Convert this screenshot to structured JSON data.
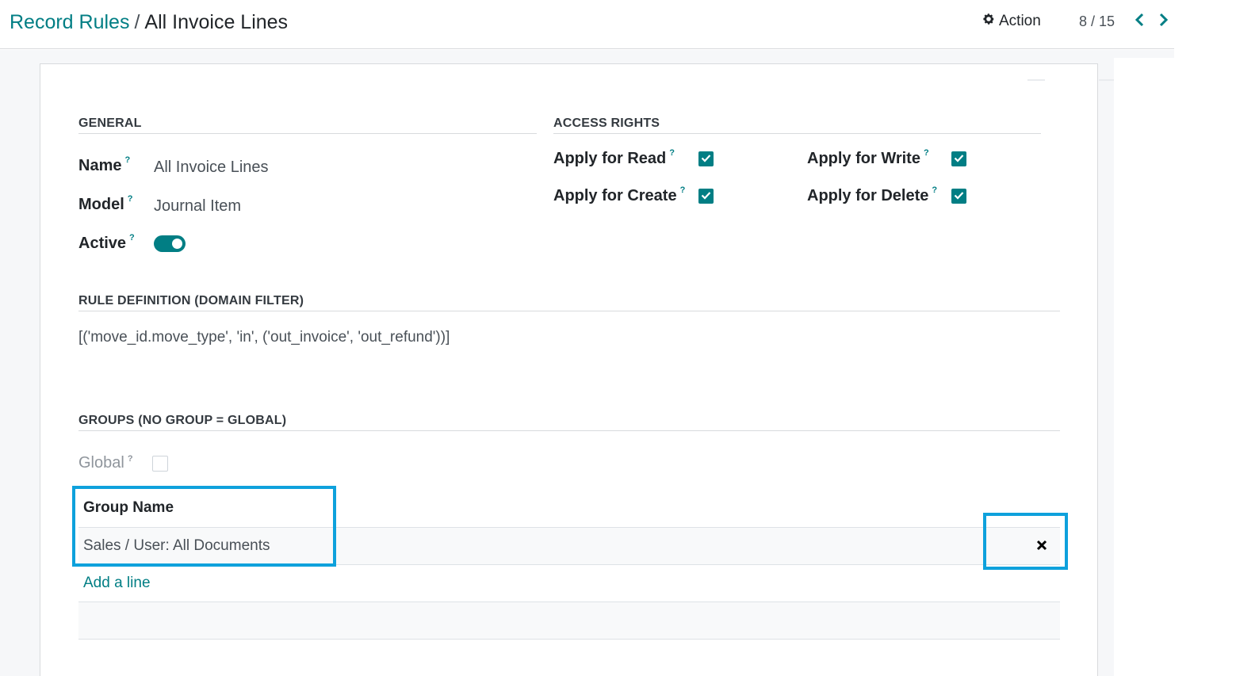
{
  "breadcrumb": {
    "parent": "Record Rules",
    "separator": "/",
    "current": "All Invoice Lines"
  },
  "header": {
    "action_label": "Action",
    "pager_value": "8 / 15"
  },
  "general": {
    "title": "GENERAL",
    "help_mark": "?",
    "name_label": "Name",
    "name_value": "All Invoice Lines",
    "model_label": "Model",
    "model_value": "Journal Item",
    "active_label": "Active",
    "active": true
  },
  "access_rights": {
    "title": "ACCESS RIGHTS",
    "read_label": "Apply for Read",
    "write_label": "Apply for Write",
    "create_label": "Apply for Create",
    "delete_label": "Apply for Delete",
    "read": true,
    "write": true,
    "create": true,
    "delete": true
  },
  "rule_definition": {
    "title": "RULE DEFINITION (DOMAIN FILTER)",
    "domain": "[('move_id.move_type', 'in', ('out_invoice', 'out_refund'))]"
  },
  "groups": {
    "title": "GROUPS (NO GROUP = GLOBAL)",
    "global_label": "Global",
    "global": false,
    "column_header": "Group Name",
    "rows": [
      {
        "name": "Sales / User: All Documents"
      }
    ],
    "add_line_label": "Add a line"
  },
  "colors": {
    "accent": "#017e84",
    "highlight": "#0ea1dc"
  },
  "icons": {
    "action": "gear-icon",
    "pager_prev": "chevron-left-icon",
    "pager_next": "chevron-right-icon",
    "delete_row": "close-icon",
    "checkbox": "check-icon"
  }
}
